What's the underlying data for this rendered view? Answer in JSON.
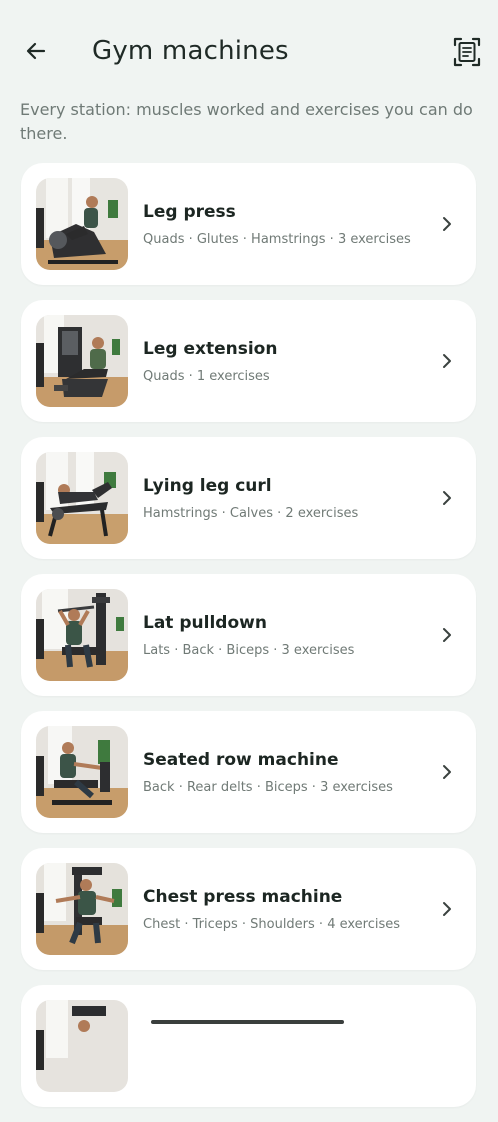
{
  "header": {
    "title": "Gym machines",
    "back_icon": "arrow-left-icon",
    "scan_icon": "scan-document-icon"
  },
  "subtitle": "Every station: muscles worked and exercises you can do there.",
  "colors": {
    "background": "#f0f4f2",
    "card": "#ffffff",
    "title_text": "#1c2622",
    "meta_text": "#707a76"
  },
  "machines": [
    {
      "name": "Leg press",
      "meta": "Quads · Glutes · Hamstrings · 3 exercises",
      "image": "leg-press-photo"
    },
    {
      "name": "Leg extension",
      "meta": "Quads · 1 exercises",
      "image": "leg-extension-photo"
    },
    {
      "name": "Lying leg curl",
      "meta": "Hamstrings · Calves · 2 exercises",
      "image": "lying-leg-curl-photo"
    },
    {
      "name": "Lat pulldown",
      "meta": "Lats · Back · Biceps · 3 exercises",
      "image": "lat-pulldown-photo"
    },
    {
      "name": "Seated row machine",
      "meta": "Back · Rear delts · Biceps · 3 exercises",
      "image": "seated-row-photo"
    },
    {
      "name": "Chest press machine",
      "meta": "Chest · Triceps · Shoulders · 4 exercises",
      "image": "chest-press-photo"
    },
    {
      "name": "",
      "meta": "",
      "image": "machine-photo"
    }
  ]
}
